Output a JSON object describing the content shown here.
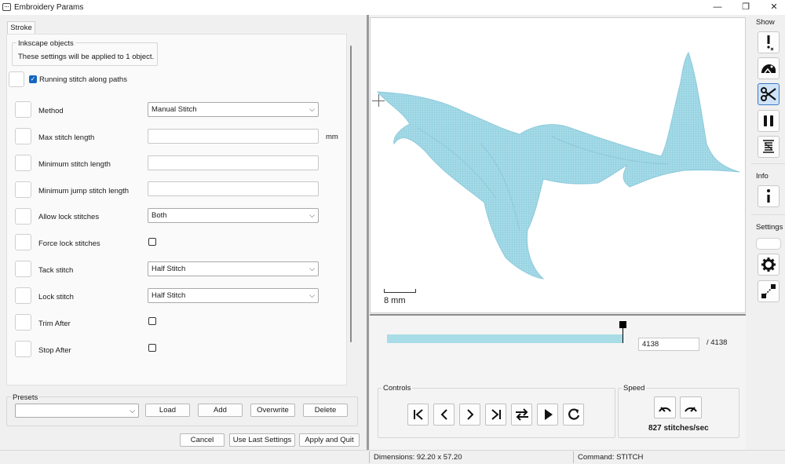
{
  "window": {
    "title": "Embroidery Params",
    "minimize": "—",
    "restore": "❐",
    "close": "✕"
  },
  "tabs": [
    {
      "label": "Stroke"
    }
  ],
  "inkscape_objects": {
    "title": "Inkscape objects",
    "text": "These settings will be applied to 1 object."
  },
  "running_stitch": {
    "label": "Running stitch along paths",
    "checked": true
  },
  "params": [
    {
      "label": "Method",
      "type": "select",
      "value": "Manual Stitch"
    },
    {
      "label": "Max stitch length",
      "type": "text",
      "value": "",
      "unit": "mm"
    },
    {
      "label": "Minimum stitch length",
      "type": "text",
      "value": ""
    },
    {
      "label": "Minimum jump stitch length",
      "type": "text",
      "value": ""
    },
    {
      "label": "Allow lock stitches",
      "type": "select",
      "value": "Both"
    },
    {
      "label": "Force lock stitches",
      "type": "checkbox",
      "checked": false
    },
    {
      "label": "Tack stitch",
      "type": "select",
      "value": "Half Stitch"
    },
    {
      "label": "Lock stitch",
      "type": "select",
      "value": "Half Stitch"
    },
    {
      "label": "Trim After",
      "type": "checkbox",
      "checked": false
    },
    {
      "label": "Stop After",
      "type": "checkbox",
      "checked": false
    }
  ],
  "presets": {
    "title": "Presets",
    "value": "",
    "buttons": {
      "load": "Load",
      "add": "Add",
      "overwrite": "Overwrite",
      "delete": "Delete"
    }
  },
  "footer": {
    "cancel": "Cancel",
    "use_last": "Use Last Settings",
    "apply_quit": "Apply and Quit"
  },
  "preview": {
    "scale_label": "8 mm",
    "fill_color": "#9fd8e6",
    "stitch_current": "4138",
    "stitch_total": "/ 4138",
    "progress": 1.0,
    "controls_title": "Controls",
    "speed_title": "Speed",
    "speed_value": "827 stitches/sec"
  },
  "sidebar": {
    "show_label": "Show",
    "info_label": "Info",
    "settings_label": "Settings",
    "active_tool": "scissors-icon"
  },
  "status": {
    "dimensions": "Dimensions: 92.20 x 57.20",
    "command": "Command: STITCH"
  }
}
